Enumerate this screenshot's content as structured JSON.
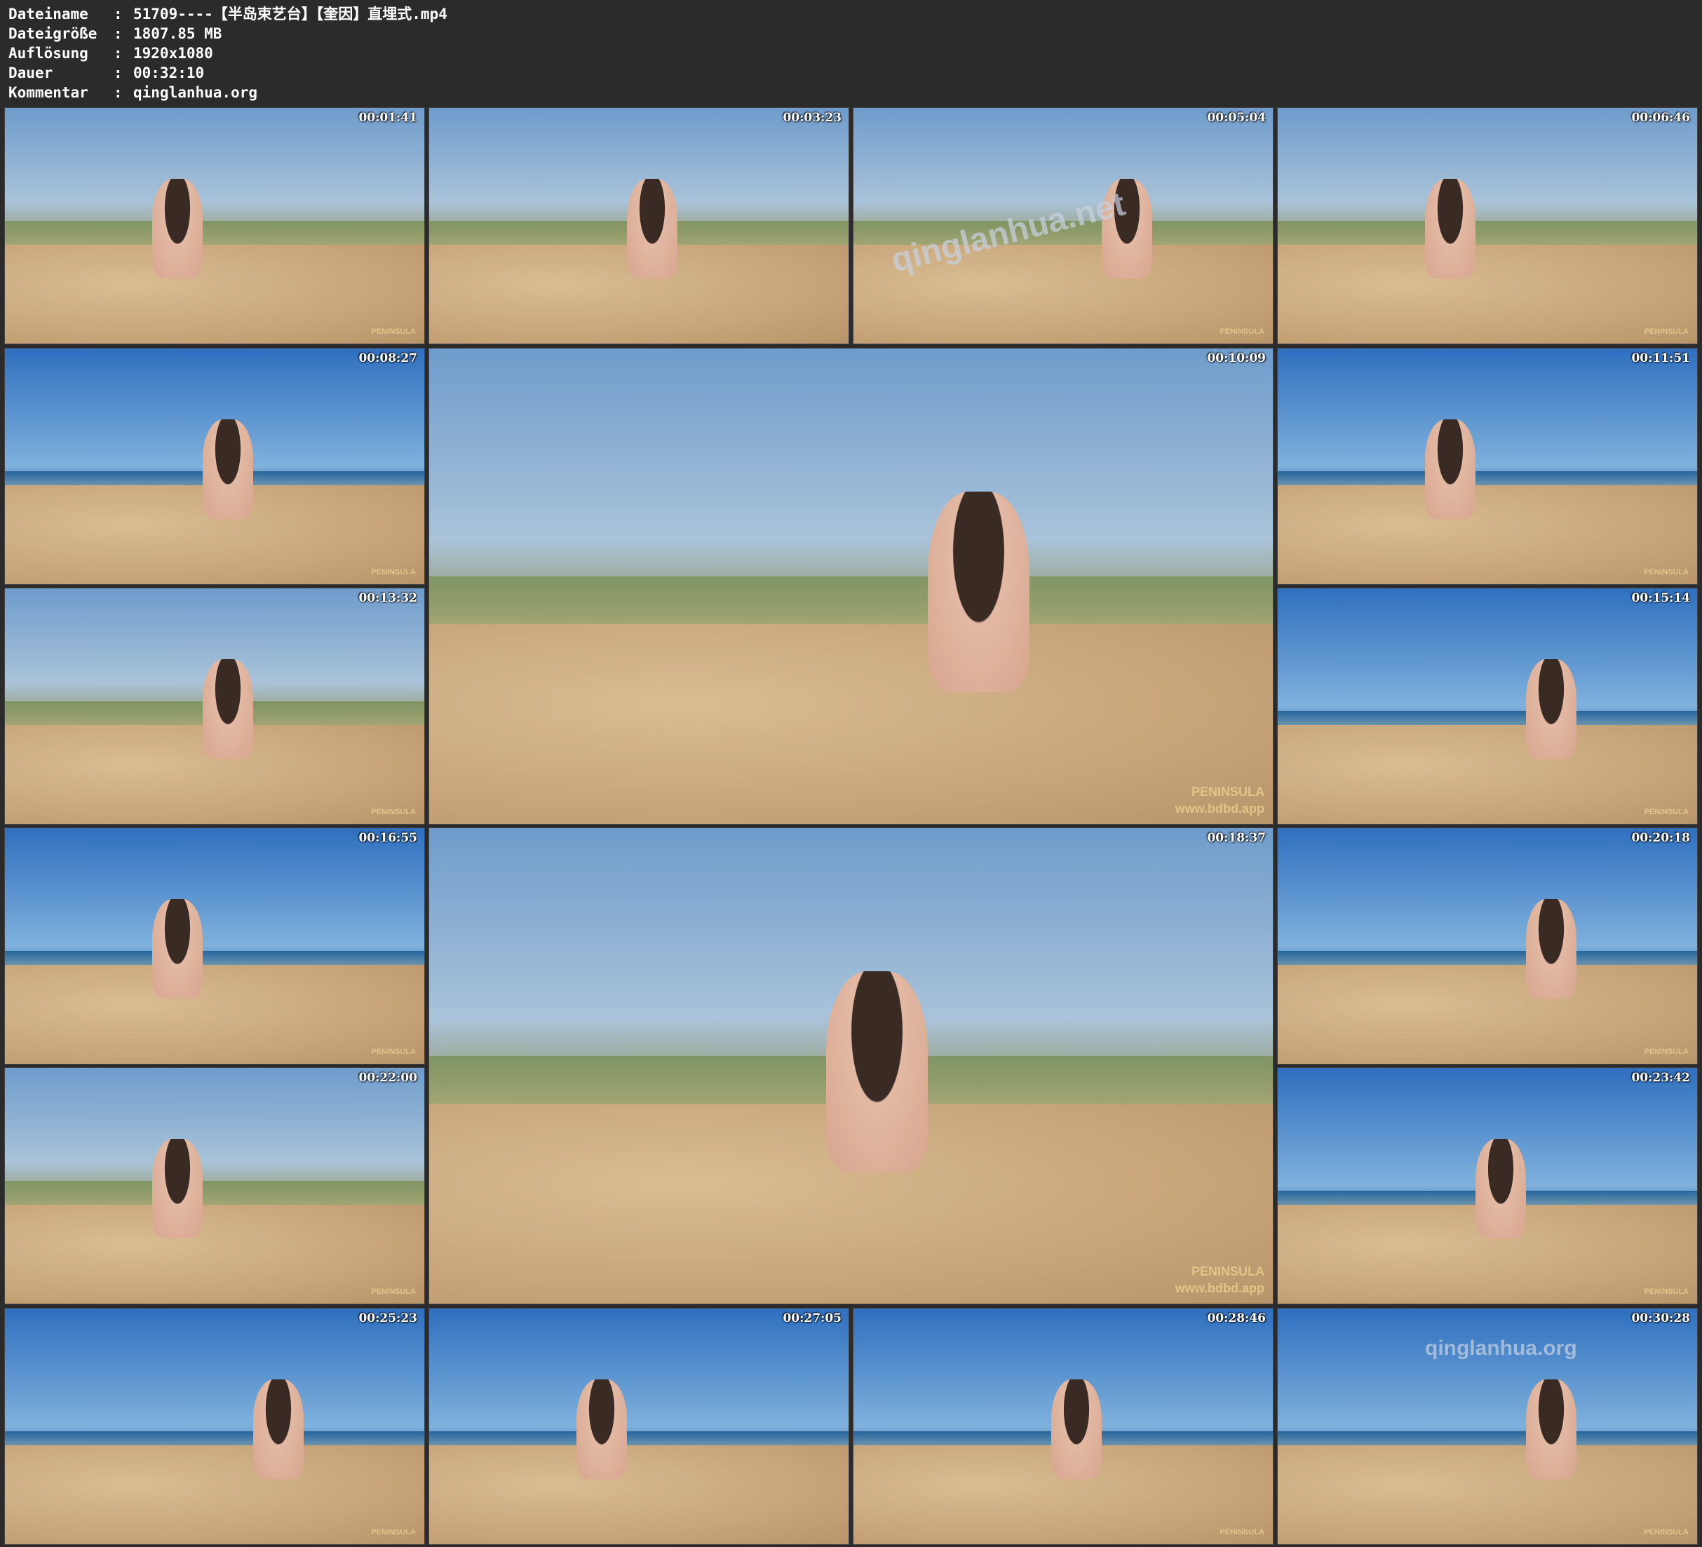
{
  "header": {
    "rows": [
      {
        "label": "Dateiname",
        "sep": ":",
        "value": "51709----【半岛束艺台】【奎因】直埋式.mp4"
      },
      {
        "label": "Dateigröße",
        "sep": ":",
        "value": "1807.85 MB"
      },
      {
        "label": "Auflösung",
        "sep": ":",
        "value": "1920x1080"
      },
      {
        "label": "Dauer",
        "sep": ":",
        "value": "00:32:10"
      },
      {
        "label": "Kommentar",
        "sep": ":",
        "value": "qinglanhua.org"
      }
    ]
  },
  "frames": [
    {
      "time": "00:01:41",
      "scene": "dune",
      "logo": "PENINSULA"
    },
    {
      "time": "00:03:23",
      "scene": "dune",
      "logo": ""
    },
    {
      "time": "00:05:04",
      "scene": "dune",
      "logo": "PENINSULA",
      "watermark": "qinglanhua.net"
    },
    {
      "time": "00:06:46",
      "scene": "dune",
      "logo": "PENINSULA"
    },
    {
      "time": "00:08:27",
      "scene": "sea",
      "logo": "PENINSULA"
    },
    {
      "time": "00:10:09",
      "scene": "dune",
      "logo": "PENINSULA",
      "logo_url": "www.bdbd.app"
    },
    {
      "time": "00:11:51",
      "scene": "sea",
      "logo": "PENINSULA"
    },
    {
      "time": "00:13:32",
      "scene": "dune",
      "logo": "PENINSULA"
    },
    {
      "time": "00:15:14",
      "scene": "sea",
      "logo": "PENINSULA"
    },
    {
      "time": "00:16:55",
      "scene": "sea",
      "logo": "PENINSULA"
    },
    {
      "time": "00:18:37",
      "scene": "dune",
      "logo": "PENINSULA",
      "logo_url": "www.bdbd.app"
    },
    {
      "time": "00:20:18",
      "scene": "sea",
      "logo": "PENINSULA"
    },
    {
      "time": "00:22:00",
      "scene": "dune",
      "logo": "PENINSULA"
    },
    {
      "time": "00:23:42",
      "scene": "sea",
      "logo": "PENINSULA"
    },
    {
      "time": "00:25:23",
      "scene": "sea",
      "logo": "PENINSULA"
    },
    {
      "time": "00:27:05",
      "scene": "sea",
      "logo": ""
    },
    {
      "time": "00:28:46",
      "scene": "sea",
      "logo": "PENINSULA"
    },
    {
      "time": "00:30:28",
      "scene": "sea",
      "logo": "PENINSULA",
      "watermark": "qinglanhua.org"
    }
  ]
}
